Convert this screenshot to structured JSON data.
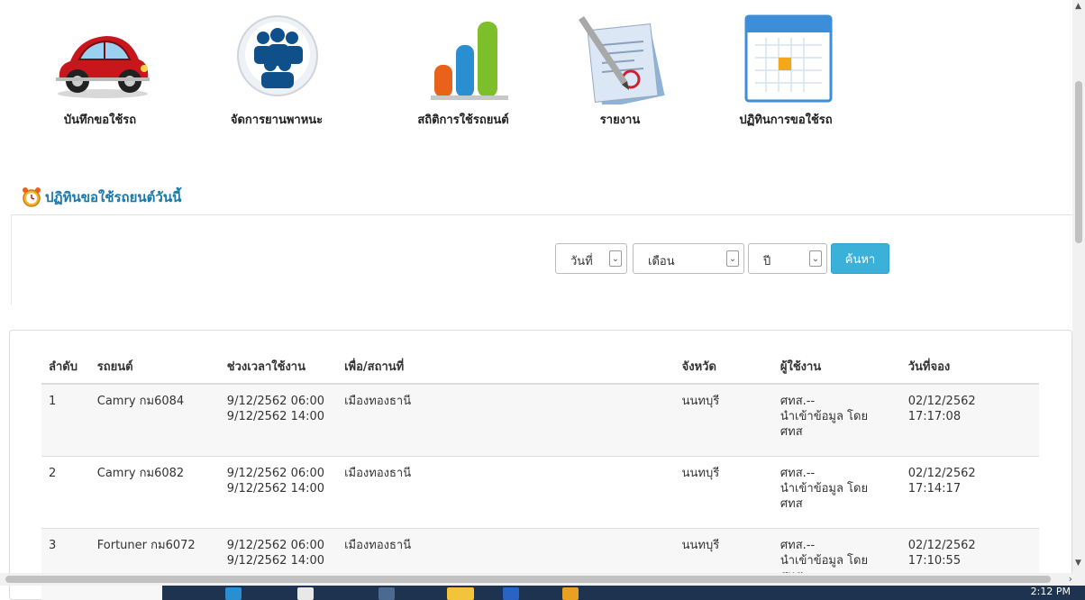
{
  "menu": [
    {
      "label": "บันทึกขอใช้รถ",
      "icon": "car-icon"
    },
    {
      "label": "จัดการยานพาหนะ",
      "icon": "users-icon"
    },
    {
      "label": "สถิติการใช้รถยนต์",
      "icon": "bar-chart-icon"
    },
    {
      "label": "รายงาน",
      "icon": "document-pen-icon"
    },
    {
      "label": "ปฏิทินการขอใช้รถ",
      "icon": "calendar-icon"
    }
  ],
  "section": {
    "title": "ปฏิทินขอใช้รถยนต์วันนี้",
    "icon": "alarm-clock-icon"
  },
  "search": {
    "day": "วันที่",
    "month": "เดือน",
    "year": "ปี",
    "button": "ค้นหา"
  },
  "table": {
    "headers": [
      "ลำดับ",
      "รถยนต์",
      "ช่วงเวลาใช้งาน",
      "เพื่อ/สถานที่",
      "จังหวัด",
      "ผู้ใช้งาน",
      "วันที่จอง"
    ],
    "rows": [
      {
        "no": "1",
        "car": "Camry กม6084",
        "time_start": "9/12/2562 06:00",
        "time_end": "9/12/2562 14:00",
        "place": "เมืองทองธานี",
        "province": "นนทบุรี",
        "user_1": "ศทส.--",
        "user_2": "นำเข้าข้อมูล โดย",
        "user_3": "ศทส",
        "booked_date": "02/12/2562",
        "booked_time": "17:17:08"
      },
      {
        "no": "2",
        "car": "Camry กม6082",
        "time_start": "9/12/2562 06:00",
        "time_end": "9/12/2562 14:00",
        "place": "เมืองทองธานี",
        "province": "นนทบุรี",
        "user_1": "ศทส.--",
        "user_2": "นำเข้าข้อมูล โดย",
        "user_3": "ศทส",
        "booked_date": "02/12/2562",
        "booked_time": "17:14:17"
      },
      {
        "no": "3",
        "car": "Fortuner กม6072",
        "time_start": "9/12/2562 06:00",
        "time_end": "9/12/2562 14:00",
        "place": "เมืองทองธานี",
        "province": "นนทบุรี",
        "user_1": "ศทส.--",
        "user_2": "นำเข้าข้อมูล โดย",
        "user_3": "ศทส",
        "booked_date": "02/12/2562",
        "booked_time": "17:10:55"
      }
    ]
  },
  "taskbar": {
    "clock": "2:12 PM"
  },
  "colors": {
    "accent": "#3bb0d9",
    "section_title": "#1a78a8",
    "taskbar": "#1e3350"
  }
}
